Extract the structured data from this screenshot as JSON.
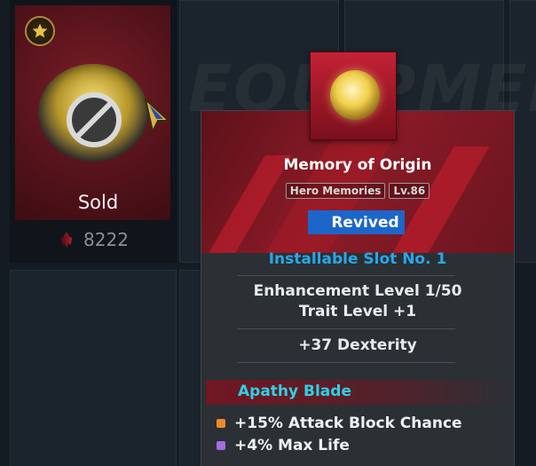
{
  "background_watermark": "EQUIPMENT",
  "sold_item": {
    "status_label": "Sold",
    "price": "8222",
    "star_icon": "star-icon",
    "price_icon": "red-crystal-icon"
  },
  "tooltip": {
    "name": "Memory of Origin",
    "tags": [
      "Hero Memories",
      "Lv.86"
    ],
    "revived_label": "Revived",
    "slot_label": "Installable Slot No. 1",
    "enhancement_label": "Enhancement Level  1/50",
    "trait_label": "Trait Level  +1",
    "main_stat": "+37 Dexterity",
    "set_name": "Apathy Blade",
    "effects": [
      {
        "text": "+15% Attack Block Chance",
        "color": "#f08a2a"
      },
      {
        "text": "+4% Max Life",
        "color": "#a56be0"
      }
    ]
  },
  "colors": {
    "accent_blue": "#1d66c9",
    "slot_blue": "#29a7e8",
    "set_cyan": "#2fd1e6",
    "header_red": "#8c1b27"
  }
}
